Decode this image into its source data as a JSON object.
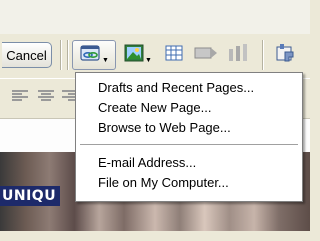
{
  "toolbar": {
    "cancel_label": "Cancel",
    "buttons": [
      {
        "icon": "hyperlink-icon",
        "active": true,
        "dropdown": true
      },
      {
        "icon": "image-icon",
        "dropdown": true
      },
      {
        "icon": "table-icon"
      },
      {
        "icon": "form-icon"
      },
      {
        "icon": "columns-icon"
      },
      {
        "icon": "plugin-icon"
      }
    ]
  },
  "link_menu": {
    "items": [
      {
        "label": "Drafts and Recent Pages..."
      },
      {
        "label": "Create New Page..."
      },
      {
        "label": "Browse to Web Page..."
      },
      {
        "label": "E-mail Address..."
      },
      {
        "label": "File on My Computer..."
      }
    ]
  },
  "page_preview": {
    "banner_text": "UNIQU"
  },
  "colors": {
    "chrome": "#ece9d8",
    "menu_bg": "#ffffff",
    "menu_border": "#808080",
    "banner_bg": "#1d2a6a"
  }
}
